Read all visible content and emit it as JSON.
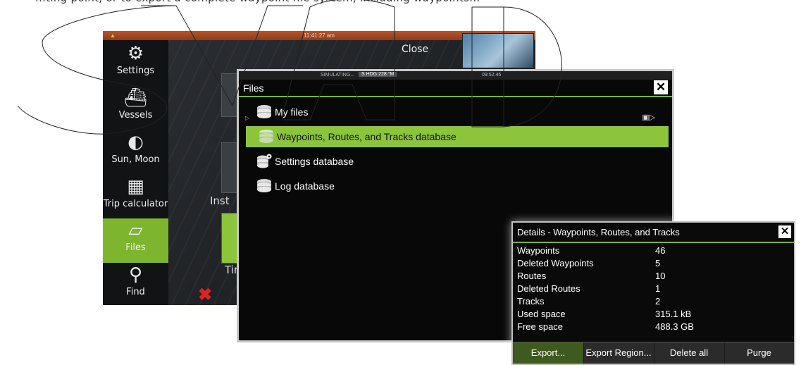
{
  "intro": {
    "text": "...ting point, or to export a complete waypoint file system, including waypoints..."
  },
  "device": {
    "clock": "11:41:27 am",
    "sidebar": [
      {
        "label": "Settings",
        "icon": "gear-icon",
        "glyph": "⚙"
      },
      {
        "label": "Vessels",
        "icon": "vessel-icon",
        "glyph": "⛴"
      },
      {
        "label": "Sun, Moon",
        "icon": "moon-icon",
        "glyph": "◐"
      },
      {
        "label": "Trip calculator",
        "icon": "calculator-icon",
        "glyph": "▦"
      },
      {
        "label": "Files",
        "icon": "folder-icon",
        "glyph": "▱"
      },
      {
        "label": "Find",
        "icon": "search-icon",
        "glyph": "⚲"
      }
    ],
    "close_label": "Close",
    "inst_label": "Inst",
    "tim_label": "Tir"
  },
  "files": {
    "title": "Files",
    "topstrip": {
      "sim": "SIMULATING...",
      "hdg": "S HDG 228 °M",
      "time": "09:52:46"
    },
    "items": [
      {
        "label": "My files",
        "icon": "database-icon"
      },
      {
        "label": "Waypoints, Routes, and Tracks database",
        "icon": "database-icon"
      },
      {
        "label": "Settings database",
        "icon": "database-settings-icon"
      },
      {
        "label": "Log database",
        "icon": "database-icon"
      }
    ],
    "selected_index": 1
  },
  "details": {
    "title": "Details - Waypoints, Routes, and Tracks",
    "rows": [
      {
        "key": "Waypoints",
        "value": "46"
      },
      {
        "key": "Deleted Waypoints",
        "value": "5"
      },
      {
        "key": "Routes",
        "value": "10"
      },
      {
        "key": "Deleted Routes",
        "value": "1"
      },
      {
        "key": "Tracks",
        "value": "2"
      },
      {
        "key": "Used space",
        "value": "315.1 kB"
      },
      {
        "key": "Free space",
        "value": "488.3 GB"
      }
    ],
    "buttons": [
      "Export...",
      "Export Region...",
      "Delete all",
      "Purge"
    ]
  },
  "colors": {
    "accent": "#8cc43c",
    "selected": "#7db52f",
    "status_bar": "#b7552a"
  }
}
